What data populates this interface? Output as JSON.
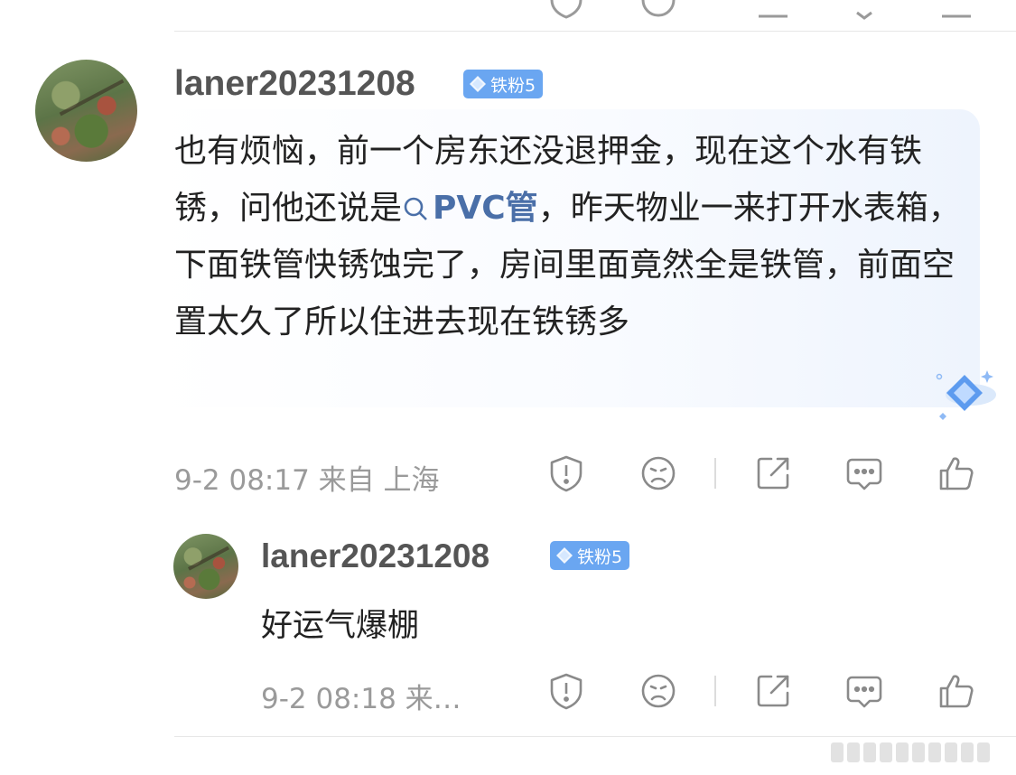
{
  "comment": {
    "username": "laner20231208",
    "badge": "铁粉5",
    "text_before_link": "也有烦恼，前一个房东还没退押金，现在这个水有铁锈，问他还说是",
    "topic_link": "PVC管",
    "text_after_link": "，昨天物业一来打开水表箱，下面铁管快锈蚀完了，房间里面竟然全是铁管，前面空置太久了所以住进去现在铁锈多",
    "meta": "9-2 08:17 来自 上海"
  },
  "reply": {
    "username": "laner20231208",
    "badge": "铁粉5",
    "text": "好运气爆棚",
    "meta": "9-2 08:18 来…"
  },
  "icons": [
    "report-icon",
    "dislike-face-icon",
    "share-icon",
    "comment-icon",
    "like-icon"
  ],
  "colors": {
    "badge": "#6aa6f1",
    "link": "#4a6fa8",
    "meta": "#9a9a9a",
    "text": "#222222"
  }
}
